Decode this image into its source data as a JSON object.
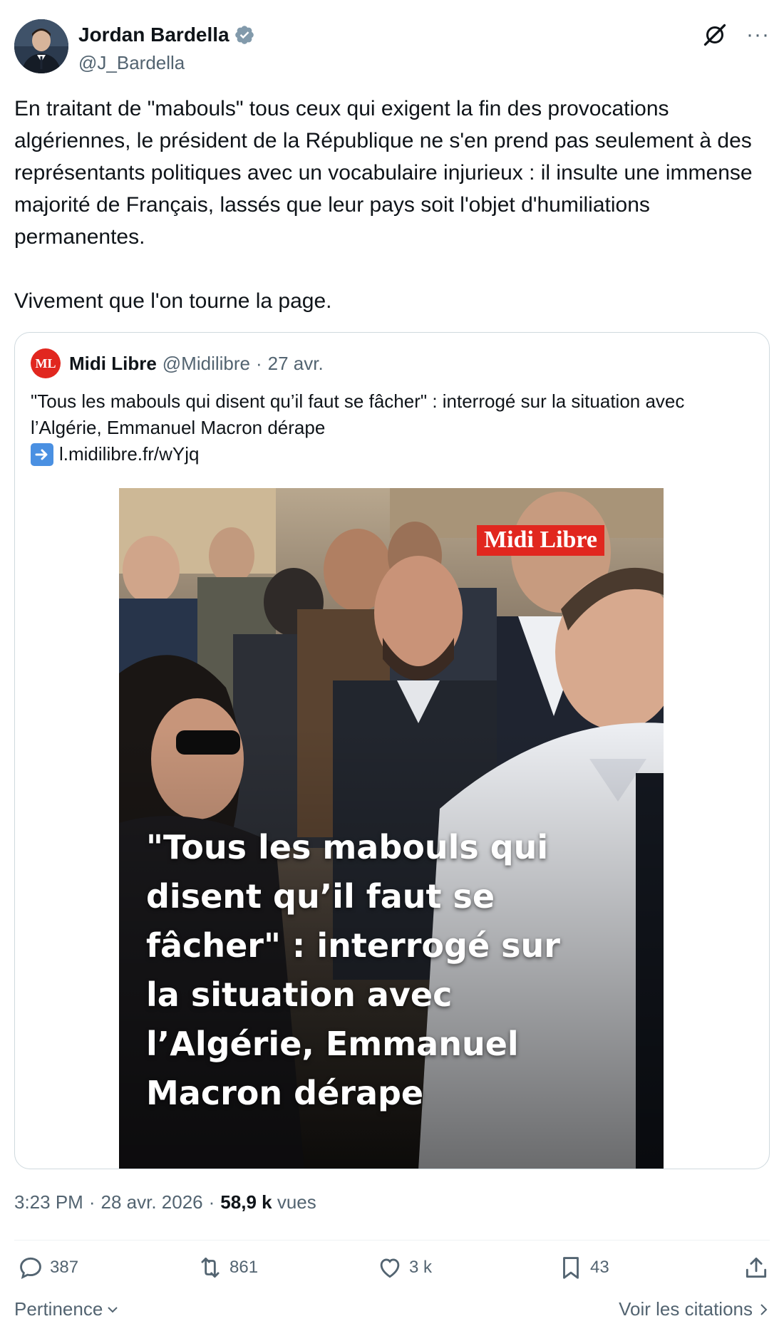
{
  "author": {
    "name": "Jordan Bardella",
    "handle": "@J_Bardella",
    "verified": true
  },
  "tweet": {
    "text": "En traitant de \"mabouls\" tous ceux qui exigent la fin des provocations algériennes, le président de la République ne s'en prend pas seulement à des représentants politiques avec un vocabulaire injurieux : il insulte une immense majorité de Français, lassés que leur pays soit l'objet d'humiliations permanentes.\n\nVivement que l'on tourne la page."
  },
  "quote": {
    "logo_text": "ML",
    "name": "Midi Libre",
    "handle": "@Midilibre",
    "separator": "·",
    "date": "27 avr.",
    "text": "\"Tous les mabouls qui disent qu’il faut se fâcher\" : interrogé sur la situation avec l’Algérie, Emmanuel Macron dérape",
    "link": "l.midilibre.fr/wYjq",
    "image": {
      "brand": "Midi Libre",
      "headline": "\"Tous les mabouls qui disent qu’il faut se fâcher\" : interrogé sur la situation avec l’Algérie, Emmanuel Macron dérape"
    }
  },
  "meta": {
    "time": "3:23 PM",
    "separator": "·",
    "date": "28 avr. 2026",
    "views_count": "58,9 k",
    "views_label": "vues"
  },
  "actions": {
    "replies": "387",
    "reposts": "861",
    "likes": "3 k",
    "bookmarks": "43"
  },
  "footer": {
    "sort_label": "Pertinence",
    "quotes_label": "Voir les citations"
  },
  "icons": [
    "verified-badge-icon",
    "grok-icon",
    "more-icon",
    "arrow-right-icon",
    "reply-icon",
    "repost-icon",
    "like-icon",
    "bookmark-icon",
    "share-icon",
    "chevron-down-icon",
    "chevron-right-icon"
  ],
  "colors": {
    "text": "#0f1419",
    "secondary": "#536471",
    "border": "#cfd9de",
    "verified": "#829aab",
    "brand_red": "#e1271f"
  }
}
